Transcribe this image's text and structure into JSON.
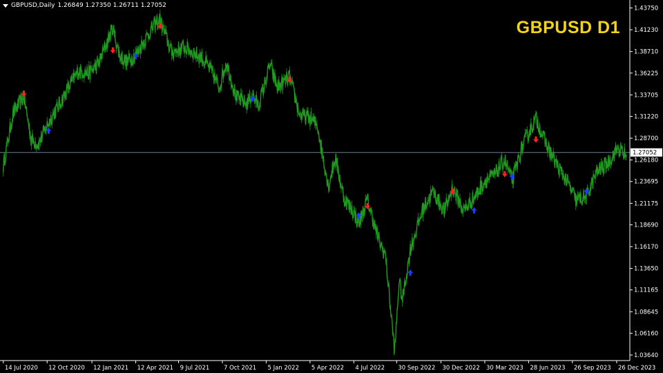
{
  "header": {
    "symbol_timeframe": "GBPUSD,Daily",
    "ohlc": "1.26849 1.27350 1.26711 1.27052",
    "menu_icon": "triangle-down-icon"
  },
  "overlay_title": "GBPUSD D1",
  "colors": {
    "background": "#000000",
    "candles": "#1f9a1f",
    "title": "#f2d419",
    "up_arrow": "#1e3cff",
    "down_arrow": "#ff2020",
    "current_price_line": "#6e7d99",
    "axis": "#ffffff"
  },
  "chart_data": {
    "type": "line",
    "title": "GBPUSD D1",
    "series": [
      {
        "x": [
          "2020-07-14",
          "2020-08-03",
          "2020-08-25",
          "2020-09-10",
          "2020-09-24",
          "2020-10-15",
          "2020-11-05",
          "2020-11-25",
          "2020-12-15",
          "2021-01-05",
          "2021-01-25",
          "2021-02-24",
          "2021-03-10",
          "2021-03-25",
          "2021-04-12",
          "2021-04-30",
          "2021-05-20",
          "2021-06-01",
          "2021-06-25",
          "2021-07-20",
          "2021-08-10",
          "2021-08-25",
          "2021-09-15",
          "2021-09-30",
          "2021-10-15",
          "2021-11-05",
          "2021-11-25",
          "2021-12-08",
          "2021-12-20",
          "2022-01-13",
          "2022-01-28",
          "2022-02-22",
          "2022-03-15",
          "2022-04-05",
          "2022-04-20",
          "2022-05-13",
          "2022-05-27",
          "2022-06-14",
          "2022-06-30",
          "2022-07-14",
          "2022-08-01",
          "2022-08-25",
          "2022-09-07",
          "2022-09-26",
          "2022-10-05",
          "2022-10-12",
          "2022-10-28",
          "2022-11-24",
          "2022-12-14",
          "2023-01-06",
          "2023-01-23",
          "2023-02-15",
          "2023-03-08",
          "2023-03-30",
          "2023-04-20",
          "2023-05-10",
          "2023-05-25",
          "2023-06-15",
          "2023-07-13",
          "2023-08-01",
          "2023-08-25",
          "2023-09-15",
          "2023-10-04",
          "2023-10-25",
          "2023-11-15",
          "2023-12-07",
          "2023-12-28",
          "2024-01-15"
        ],
        "values": [
          1.255,
          1.315,
          1.335,
          1.285,
          1.28,
          1.305,
          1.325,
          1.345,
          1.365,
          1.362,
          1.372,
          1.415,
          1.382,
          1.375,
          1.383,
          1.4,
          1.418,
          1.423,
          1.386,
          1.392,
          1.386,
          1.38,
          1.364,
          1.345,
          1.375,
          1.334,
          1.327,
          1.338,
          1.324,
          1.372,
          1.345,
          1.358,
          1.314,
          1.31,
          1.302,
          1.231,
          1.265,
          1.217,
          1.205,
          1.188,
          1.216,
          1.168,
          1.152,
          1.04,
          1.123,
          1.1,
          1.158,
          1.207,
          1.225,
          1.203,
          1.23,
          1.203,
          1.218,
          1.237,
          1.245,
          1.262,
          1.238,
          1.277,
          1.31,
          1.283,
          1.256,
          1.237,
          1.215,
          1.219,
          1.248,
          1.258,
          1.275,
          1.266
        ]
      }
    ],
    "current_price": 1.27052,
    "ylim": [
      1.03,
      1.4435
    ],
    "y_ticks": [
      "1.43750",
      "1.41230",
      "1.38710",
      "1.36225",
      "1.33705",
      "1.31220",
      "1.28700",
      "1.26180",
      "1.23695",
      "1.21175",
      "1.18690",
      "1.16170",
      "1.13650",
      "1.11165",
      "1.08645",
      "1.06160",
      "1.03640"
    ],
    "x_ticks": [
      "14 Jul 2020",
      "12 Oct 2020",
      "12 Jan 2021",
      "12 Apr 2021",
      "9 Jul 2021",
      "7 Oct 2021",
      "5 Jan 2022",
      "5 Apr 2022",
      "4 Jul 2022",
      "30 Sep 2022",
      "30 Dec 2022",
      "30 Mar 2023",
      "28 Jun 2023",
      "26 Sep 2023",
      "26 Dec 2023"
    ],
    "x_tick_dates": [
      "2020-07-14",
      "2020-10-12",
      "2021-01-12",
      "2021-04-12",
      "2021-07-09",
      "2021-10-07",
      "2022-01-05",
      "2022-04-05",
      "2022-07-04",
      "2022-09-30",
      "2022-12-30",
      "2023-03-30",
      "2023-06-28",
      "2023-09-26",
      "2023-12-26"
    ],
    "x_range": [
      "2020-07-10",
      "2024-01-22"
    ],
    "signals": [
      {
        "type": "sell",
        "date": "2020-08-25",
        "price": 1.338
      },
      {
        "type": "buy",
        "date": "2020-10-15",
        "price": 1.296
      },
      {
        "type": "sell",
        "date": "2021-02-24",
        "price": 1.388
      },
      {
        "type": "buy",
        "date": "2021-04-12",
        "price": 1.382
      },
      {
        "type": "sell",
        "date": "2021-06-01",
        "price": 1.416
      },
      {
        "type": "buy",
        "date": "2021-12-08",
        "price": 1.333
      },
      {
        "type": "sell",
        "date": "2022-02-22",
        "price": 1.354
      },
      {
        "type": "buy",
        "date": "2022-07-14",
        "price": 1.198
      },
      {
        "type": "sell",
        "date": "2022-08-01",
        "price": 1.208
      },
      {
        "type": "buy",
        "date": "2022-10-28",
        "price": 1.132
      },
      {
        "type": "sell",
        "date": "2023-01-23",
        "price": 1.225
      },
      {
        "type": "buy",
        "date": "2023-03-08",
        "price": 1.204
      },
      {
        "type": "sell",
        "date": "2023-05-10",
        "price": 1.245
      },
      {
        "type": "buy",
        "date": "2023-05-25",
        "price": 1.243
      },
      {
        "type": "sell",
        "date": "2023-07-13",
        "price": 1.285
      },
      {
        "type": "buy",
        "date": "2023-10-25",
        "price": 1.226
      }
    ],
    "grid": false
  }
}
